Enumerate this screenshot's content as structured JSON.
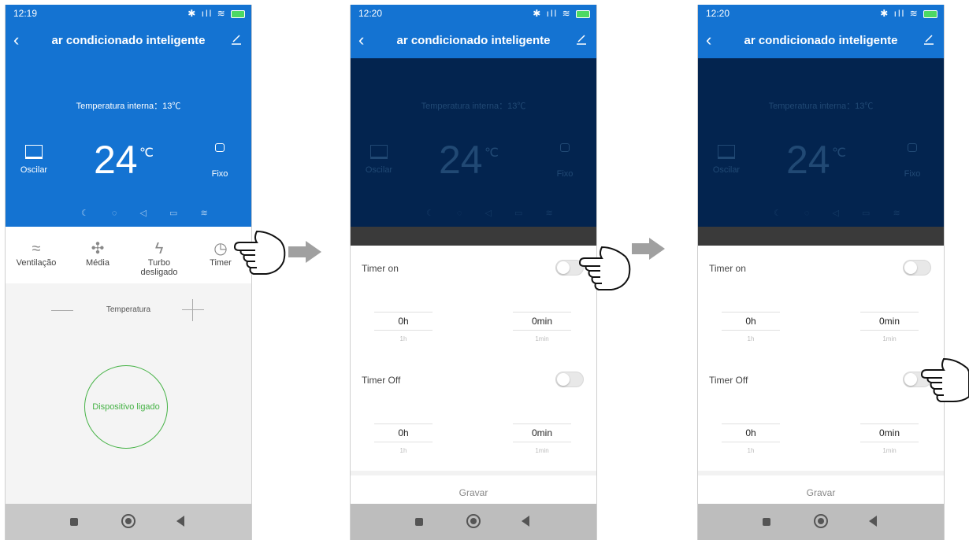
{
  "status": {
    "time1": "12:19",
    "time2": "12:20",
    "time3": "12:20",
    "dots": "≐ ···"
  },
  "header": {
    "title": "ar condicionado inteligente"
  },
  "hero": {
    "internal_temp": "Temperatura interna：13℃",
    "oscillate": "Oscilar",
    "setpoint": "24",
    "unit": "℃",
    "fixed": "Fixo"
  },
  "modes": [
    {
      "label": "Ventilação"
    },
    {
      "label": "Média"
    },
    {
      "label": "Turbo desligado"
    },
    {
      "label": "Timer"
    }
  ],
  "temperature_label": "Temperatura",
  "power_label": "Dispositivo ligado",
  "timer": {
    "on_label": "Timer on",
    "off_label": "Timer Off",
    "hours": "0h",
    "minutes": "0min",
    "next_hours": "1h",
    "next_minutes": "1min",
    "save": "Gravar"
  },
  "colors": {
    "primary": "#1473d2",
    "dark": "#03244f",
    "green": "#45b245"
  }
}
